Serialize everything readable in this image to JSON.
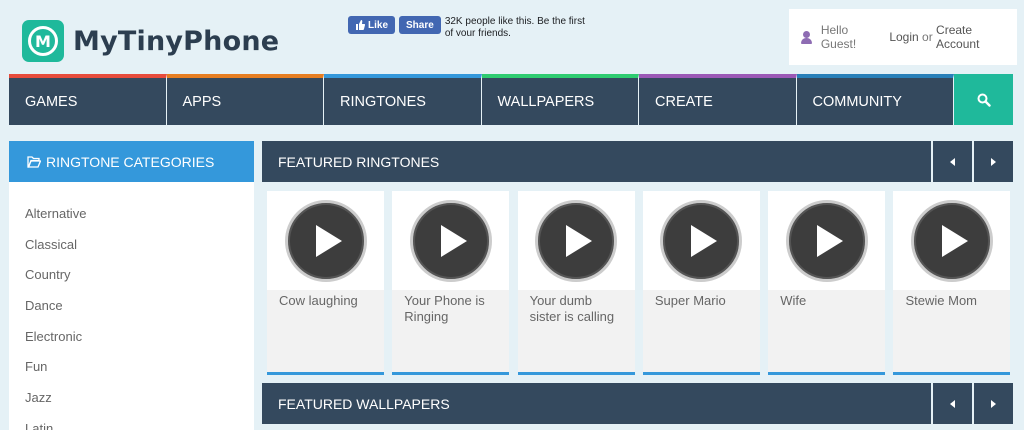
{
  "header": {
    "logo_letter": "M",
    "logo_text": "MyTinyPhone",
    "fb_like": "Like",
    "fb_share": "Share",
    "fb_text": "32K people like this. Be the first of your friends.",
    "account_greeting": "Hello Guest!",
    "login": "Login",
    "or": "or",
    "create_account": "Create Account"
  },
  "nav": {
    "items": [
      {
        "label": "GAMES",
        "color": "#e74c3c"
      },
      {
        "label": "APPS",
        "color": "#e67e22"
      },
      {
        "label": "RINGTONES",
        "color": "#3498db"
      },
      {
        "label": "WALLPAPERS",
        "color": "#2ecc71"
      },
      {
        "label": "CREATE",
        "color": "#9b59b6"
      },
      {
        "label": "COMMUNITY",
        "color": "#2980b9"
      }
    ],
    "search_icon": "search-icon"
  },
  "sidebar": {
    "title": "RINGTONE CATEGORIES",
    "icon": "folder-open-icon",
    "items": [
      "Alternative",
      "Classical",
      "Country",
      "Dance",
      "Electronic",
      "Fun",
      "Jazz",
      "Latin"
    ]
  },
  "featured_ringtones": {
    "title": "FEATURED RINGTONES",
    "items": [
      "Cow laughing",
      "Your Phone is Ringing",
      "Your dumb sister is calling",
      "Super Mario",
      "Wife",
      "Stewie Mom"
    ]
  },
  "featured_wallpapers": {
    "title": "FEATURED WALLPAPERS"
  },
  "colors": {
    "nav_bg": "#34495e",
    "accent_teal": "#1fb99b",
    "accent_blue": "#3498db",
    "page_bg": "#e5f1f6"
  }
}
